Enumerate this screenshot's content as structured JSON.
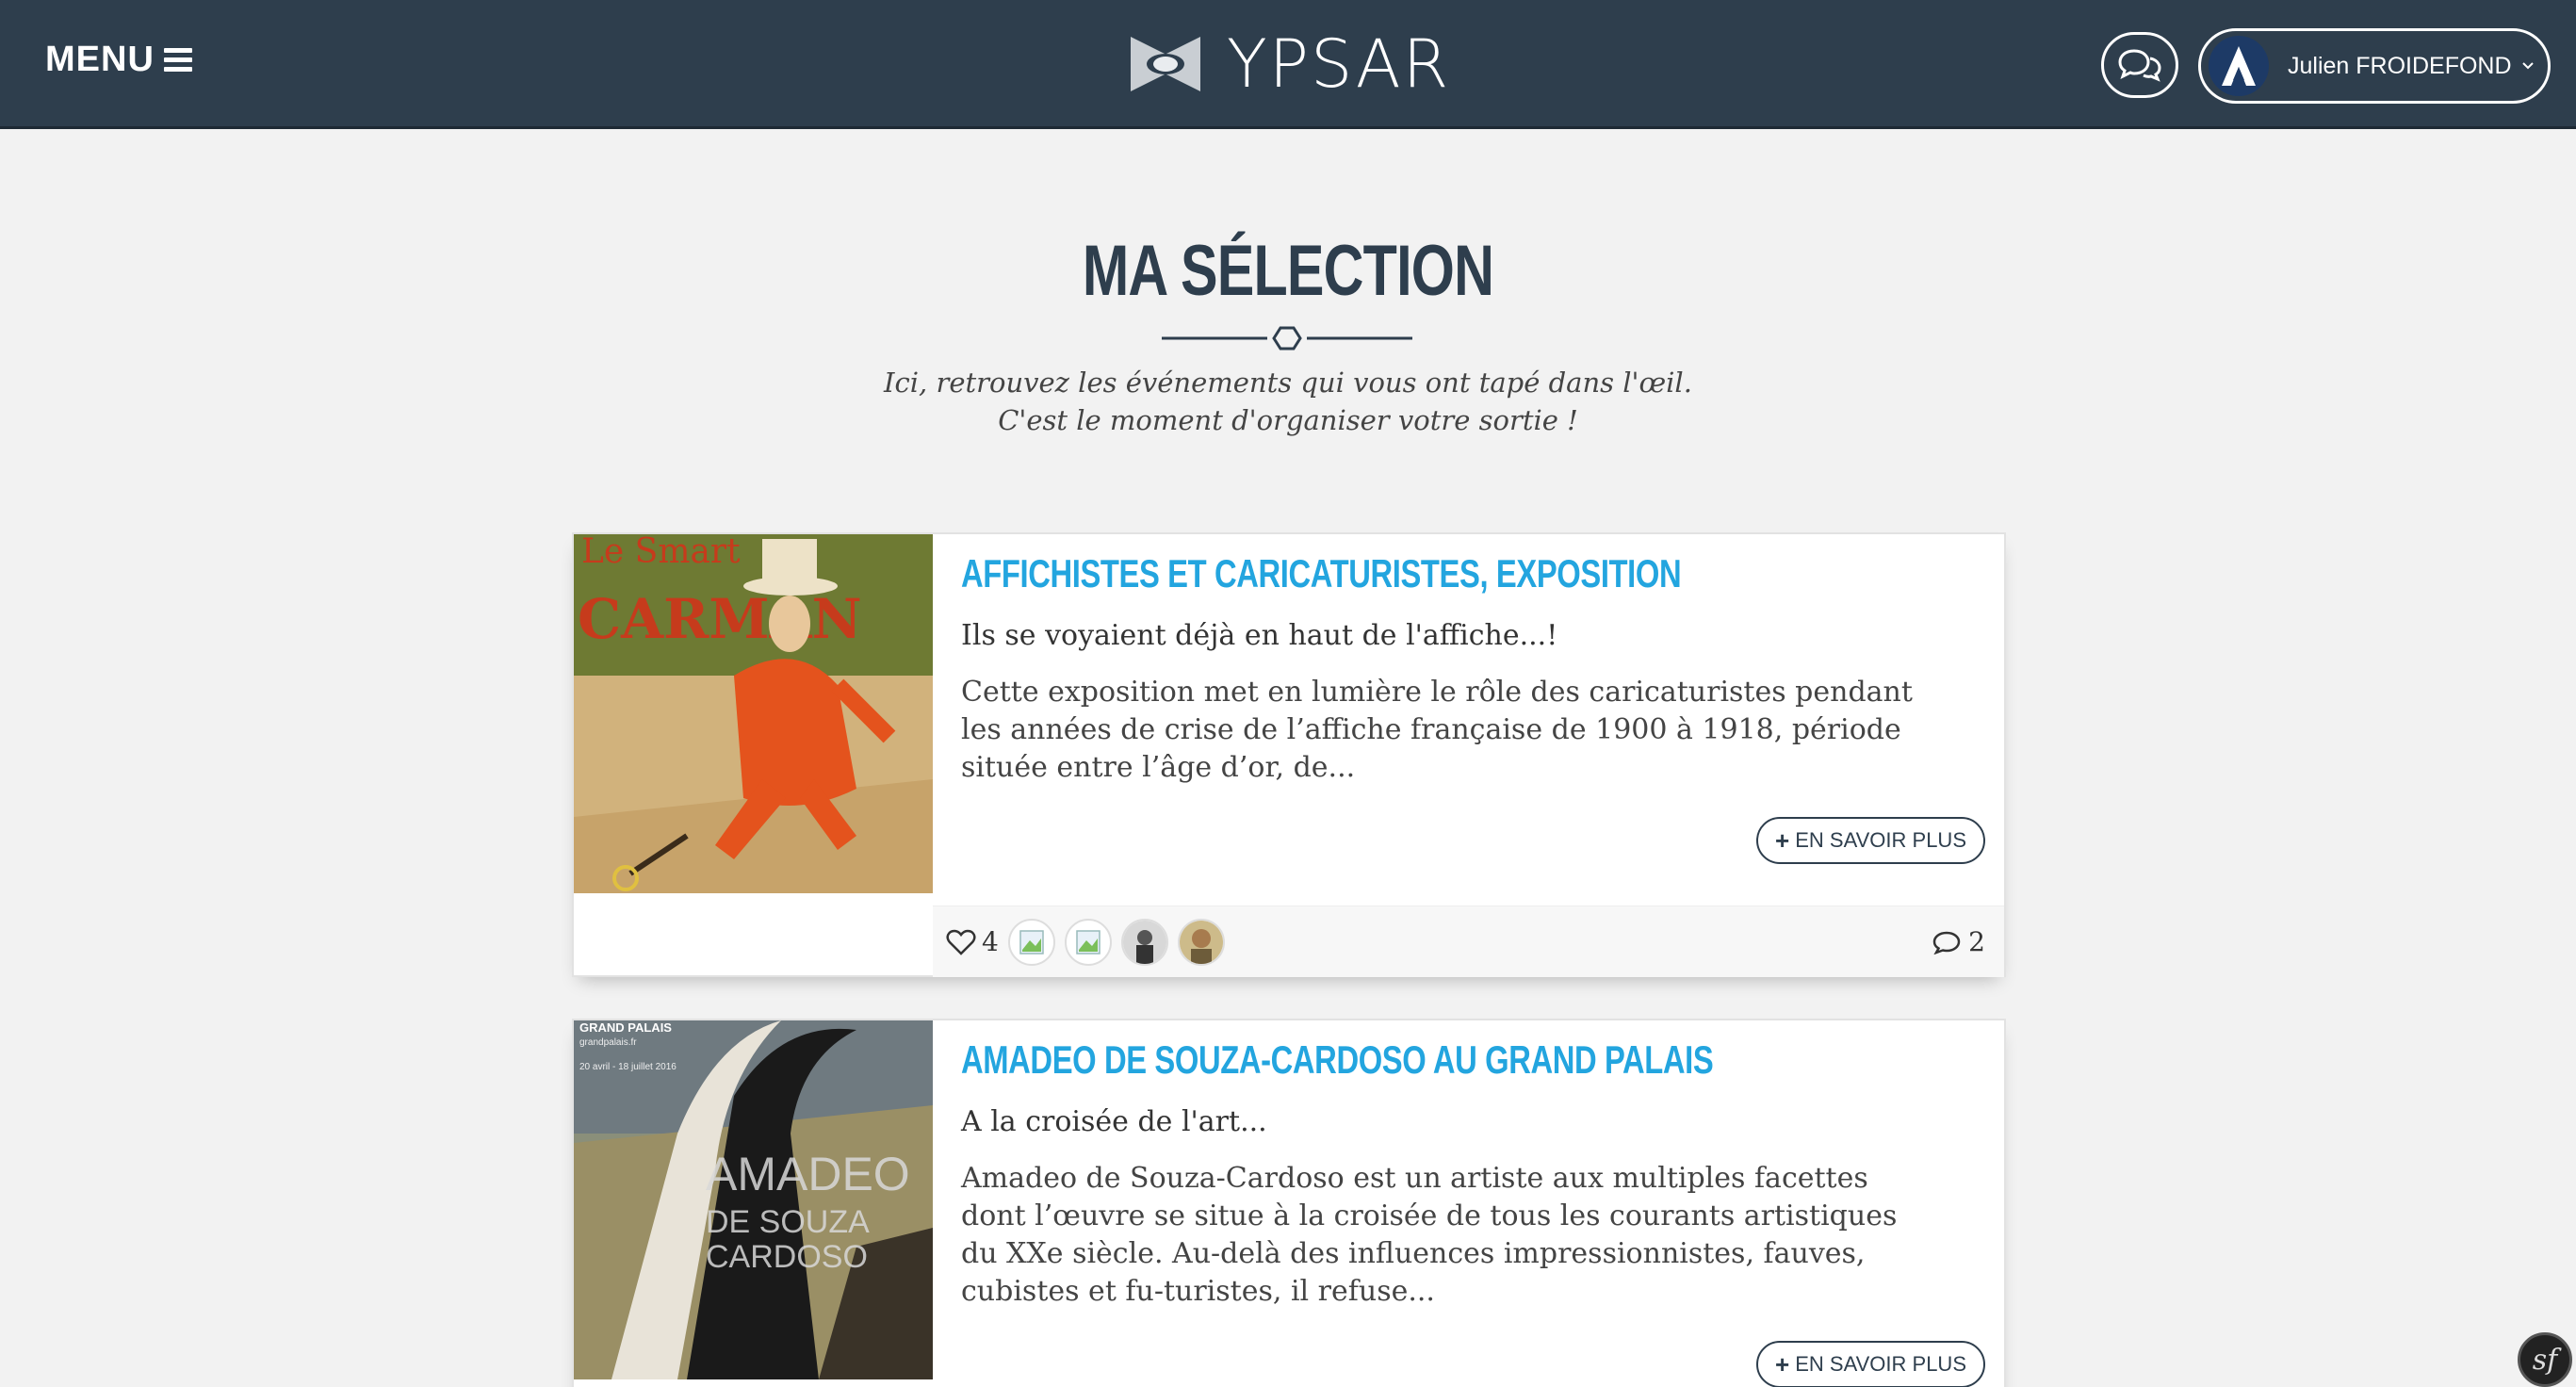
{
  "header": {
    "menu_label": "MENU",
    "logo_text": "YPSAR",
    "user_name": "Julien FROIDEFOND"
  },
  "page": {
    "title": "MA SÉLECTION",
    "subtitle_line1": "Ici, retrouvez les événements qui vous ont tapé dans l'œil.",
    "subtitle_line2": "C'est le moment d'organiser votre sortie !"
  },
  "cards": [
    {
      "title": "AFFICHISTES ET CARICATURISTES, EXPOSITION",
      "tagline": "Ils se voyaient déjà en haut de l'affiche...!",
      "description": "Cette exposition met en lumière le rôle des caricaturistes pendant les années de crise de l’affiche française de 1900 à 1918, période située entre l’âge d’or, de...",
      "more_label": "EN SAVOIR PLUS",
      "likes": "4",
      "comments": "2",
      "poster_text_1": "Le Smart",
      "poster_text_2": "CARMAN"
    },
    {
      "title": "AMADEO DE SOUZA-CARDOSO AU GRAND PALAIS",
      "tagline": "A la croisée de l'art...",
      "description": "Amadeo de Souza-Cardoso est un artiste aux multiples facettes dont l’œuvre se situe à la croisée de tous les courants artistiques du XXe siècle. Au-delà des influences impressionnistes, fauves, cubistes et fu-turistes, il refuse...",
      "more_label": "EN SAVOIR PLUS",
      "poster_header": "GRAND PALAIS",
      "poster_site": "grandpalais.fr",
      "poster_dates": "20 avril - 18 juillet 2016",
      "poster_name_1": "AMADEO",
      "poster_name_2": "DE SOUZA",
      "poster_name_3": "CARDOSO"
    }
  ],
  "colors": {
    "header_bg": "#2e3e4d",
    "title_accent": "#23a5df",
    "page_bg": "#f2f2f2"
  },
  "icons": {
    "menu": "hamburger-icon",
    "logo": "ypsar-logo-icon",
    "chat": "chat-bubbles-icon",
    "avatar": "user-avatar-icon",
    "heart": "heart-icon",
    "comment": "comment-icon",
    "plus": "plus-icon",
    "debug": "symfony-icon"
  }
}
